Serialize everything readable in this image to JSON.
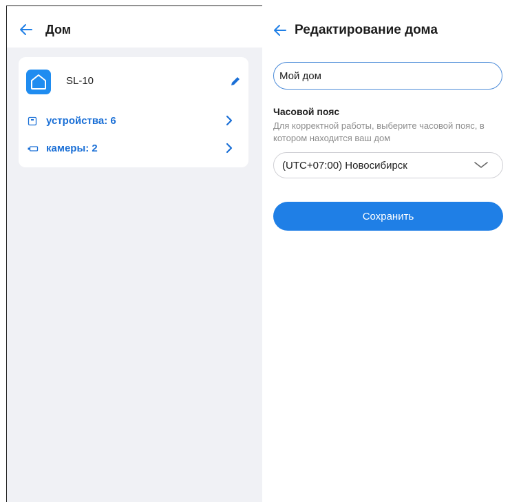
{
  "colors": {
    "accent": "#1f7fe6",
    "link": "#1a6fd6",
    "panel_bg": "#f0f1f5",
    "hint": "#8c8c8c"
  },
  "home_screen": {
    "title": "Дом",
    "back_icon": "arrow-left-icon",
    "card": {
      "icon": "home-icon",
      "name": "SL-10",
      "edit_icon": "pencil-icon",
      "rows": [
        {
          "icon": "device-icon",
          "label": "устройства: 6",
          "chevron": "chevron-right-icon"
        },
        {
          "icon": "camera-icon",
          "label": "камеры: 2",
          "chevron": "chevron-right-icon"
        }
      ]
    }
  },
  "edit_screen": {
    "title": "Редактирование дома",
    "back_icon": "arrow-left-icon",
    "name_input": {
      "value": "Мой дом"
    },
    "timezone": {
      "heading": "Часовой пояс",
      "hint": "Для корректной работы, выберите часовой пояс, в котором находится ваш дом",
      "selected": "(UTC+07:00) Новосибирск",
      "chevron": "chevron-down-icon"
    },
    "save_label": "Сохранить"
  }
}
